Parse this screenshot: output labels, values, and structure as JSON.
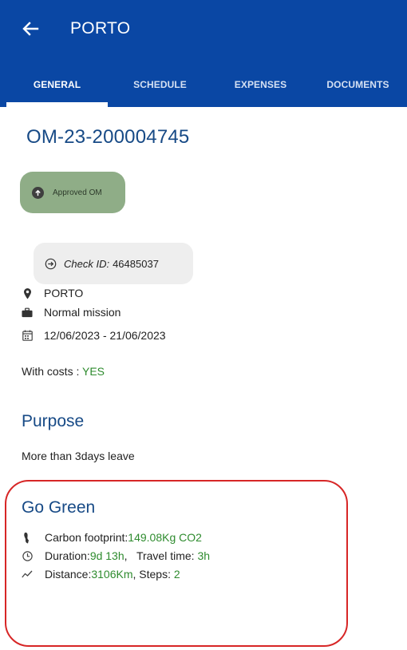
{
  "header": {
    "title": "PORTO",
    "bg_color": "#0a47a4"
  },
  "tabs": [
    {
      "label": "GENERAL",
      "active": true
    },
    {
      "label": "SCHEDULE",
      "active": false
    },
    {
      "label": "EXPENSES",
      "active": false
    },
    {
      "label": "DOCUMENTS",
      "active": false
    }
  ],
  "mission": {
    "code": "OM-23-200004745",
    "status": "Approved OM",
    "check_label": "Check ID:",
    "check_id": "46485037",
    "location": "PORTO",
    "type": "Normal mission",
    "dates": "12/06/2023 - 21/06/2023",
    "costs_label": "With costs : ",
    "costs_value": "YES"
  },
  "purpose": {
    "title": "Purpose",
    "text": "More than 3days leave"
  },
  "go_green": {
    "title": "Go Green",
    "carbon_label": "Carbon footprint: ",
    "carbon_value": "149.08Kg CO2",
    "duration_label": "Duration: ",
    "duration_value": "9d 13h",
    "travel_label": ",   Travel time: ",
    "travel_value": "3h",
    "distance_label": "Distance: ",
    "distance_value": "3106Km",
    "steps_label": ", Steps: ",
    "steps_value": "2",
    "highlight_color": "#d72626"
  },
  "icons": {
    "back": "arrow-left-icon",
    "status": "arrow-up-circle-icon",
    "check": "arrow-right-circle-icon",
    "location": "map-pin-icon",
    "type": "briefcase-icon",
    "dates": "calendar-icon",
    "carbon": "footprint-icon",
    "duration": "clock-icon",
    "distance": "trend-line-icon"
  },
  "colors": {
    "accent": "#174a86",
    "green_value": "#2e8b2e",
    "badge_bg": "#8fad87"
  }
}
